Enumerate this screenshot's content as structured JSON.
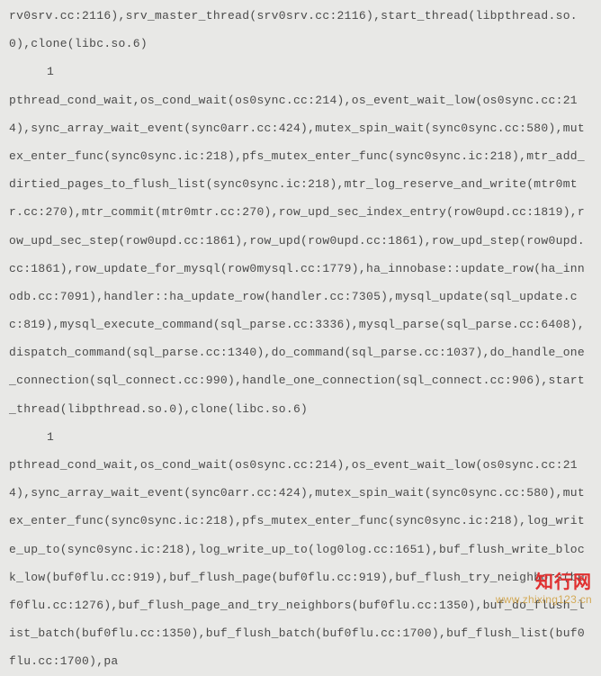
{
  "blocks": [
    {
      "type": "trace",
      "text": "rv0srv.cc:2116),srv_master_thread(srv0srv.cc:2116),start_thread(libpthread.so.0),clone(libc.so.6)"
    },
    {
      "type": "count",
      "text": "1"
    },
    {
      "type": "trace",
      "text": "pthread_cond_wait,os_cond_wait(os0sync.cc:214),os_event_wait_low(os0sync.cc:214),sync_array_wait_event(sync0arr.cc:424),mutex_spin_wait(sync0sync.cc:580),mutex_enter_func(sync0sync.ic:218),pfs_mutex_enter_func(sync0sync.ic:218),mtr_add_dirtied_pages_to_flush_list(sync0sync.ic:218),mtr_log_reserve_and_write(mtr0mtr.cc:270),mtr_commit(mtr0mtr.cc:270),row_upd_sec_index_entry(row0upd.cc:1819),row_upd_sec_step(row0upd.cc:1861),row_upd(row0upd.cc:1861),row_upd_step(row0upd.cc:1861),row_update_for_mysql(row0mysql.cc:1779),ha_innobase::update_row(ha_innodb.cc:7091),handler::ha_update_row(handler.cc:7305),mysql_update(sql_update.cc:819),mysql_execute_command(sql_parse.cc:3336),mysql_parse(sql_parse.cc:6408),dispatch_command(sql_parse.cc:1340),do_command(sql_parse.cc:1037),do_handle_one_connection(sql_connect.cc:990),handle_one_connection(sql_connect.cc:906),start_thread(libpthread.so.0),clone(libc.so.6)"
    },
    {
      "type": "count",
      "text": "1"
    },
    {
      "type": "trace",
      "text": "pthread_cond_wait,os_cond_wait(os0sync.cc:214),os_event_wait_low(os0sync.cc:214),sync_array_wait_event(sync0arr.cc:424),mutex_spin_wait(sync0sync.cc:580),mutex_enter_func(sync0sync.ic:218),pfs_mutex_enter_func(sync0sync.ic:218),log_write_up_to(sync0sync.ic:218),log_write_up_to(log0log.cc:1651),buf_flush_write_block_low(buf0flu.cc:919),buf_flush_page(buf0flu.cc:919),buf_flush_try_neighbors(buf0flu.cc:1276),buf_flush_page_and_try_neighbors(buf0flu.cc:1350),buf_do_flush_list_batch(buf0flu.cc:1350),buf_flush_batch(buf0flu.cc:1700),buf_flush_list(buf0flu.cc:1700),pa"
    }
  ],
  "watermark": {
    "title": "知行网",
    "url": "www.zhixing123.cn"
  }
}
